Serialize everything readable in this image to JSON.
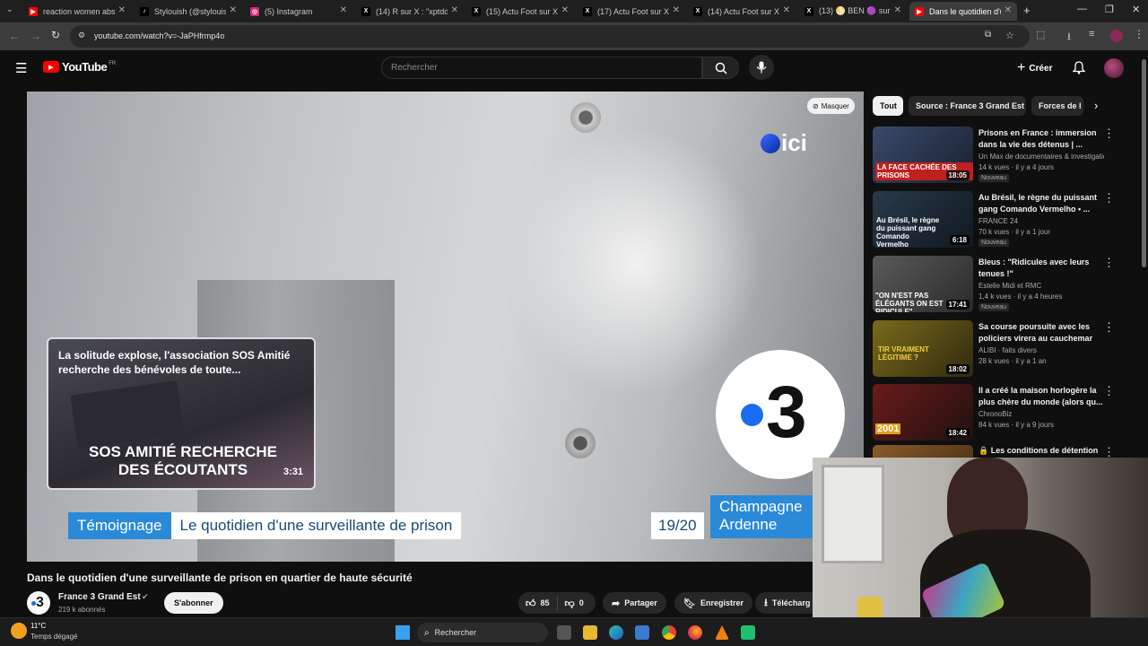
{
  "browser": {
    "tabs": [
      {
        "label": "reaction women abs",
        "icon": "youtube-icon",
        "color": "#ff0000"
      },
      {
        "label": "Stylouish (@stylouish",
        "icon": "tiktok-icon",
        "color": "#000000"
      },
      {
        "label": "(5) Instagram",
        "icon": "instagram-icon",
        "color": "#d62976"
      },
      {
        "label": "(14) R sur X : \"xptdd",
        "icon": "x-icon",
        "color": "#000000"
      },
      {
        "label": "(15) Actu Foot sur X",
        "icon": "x-icon",
        "color": "#000000"
      },
      {
        "label": "(17) Actu Foot sur X",
        "icon": "x-icon",
        "color": "#000000"
      },
      {
        "label": "(14) Actu Foot sur X",
        "icon": "x-icon",
        "color": "#000000"
      },
      {
        "label": "(13) 🌕 BEN 🟣 sur",
        "icon": "x-icon",
        "color": "#000000"
      },
      {
        "label": "Dans le quotidien d'u",
        "icon": "youtube-icon",
        "color": "#ff0000"
      }
    ],
    "url": "youtube.com/watch?v=-JaPHfrmp4o"
  },
  "youtube": {
    "logo_text": "YouTube",
    "region": "FR",
    "search_placeholder": "Rechercher",
    "create_label": "Créer"
  },
  "video": {
    "hide_label": "Masquer",
    "ici_logo": "ici",
    "channel_logo_number": "3",
    "endcard": {
      "title": "La solitude explose, l'association SOS Amitié recherche des bénévoles de toute...",
      "caption": "SOS AMITIÉ RECHERCHE DES ÉCOUTANTS",
      "duration": "3:31"
    },
    "lower_third": {
      "tag": "Témoignage",
      "text": "Le quotidien d'une surveillante de prison",
      "time": "19/20",
      "region_line1": "Champagne",
      "region_line2": "Ardenne"
    },
    "title": "Dans le quotidien d'une surveillante de prison en quartier de haute sécurité",
    "channel": "France 3 Grand Est",
    "subscribers": "219 k abonnés",
    "subscribe_label": "S'abonner",
    "likes": "85",
    "dislikes": "0",
    "share_label": "Partager",
    "save_label": "Enregistrer",
    "download_label": "Télécharg"
  },
  "chips": [
    "Tout",
    "Source : France 3 Grand Est",
    "Forces de l"
  ],
  "recommendations": [
    {
      "title": "Prisons en France : immersion dans la vie des détenus | ...",
      "channel": "Un Max de documentaires & investigatio...",
      "meta": "14 k vues · il y a 4 jours",
      "badge": "Nouveau",
      "duration": "18:05",
      "thumb_text": "LA FACE CACHÉE DES PRISONS",
      "thumb_color": "#3a4a6a"
    },
    {
      "title": "Au Brésil, le règne du puissant gang Comando Vermelho • ...",
      "channel": "FRANCE 24",
      "meta": "70 k vues · il y a 1 jour",
      "badge": "Nouveau",
      "duration": "6:18",
      "thumb_text": "Au Brésil, le règne du puissant gang Comando Vermelho",
      "thumb_color": "#2a3a4a"
    },
    {
      "title": "Bleus : \"Ridicules avec leurs tenues !\"",
      "channel": "Estelle Midi et RMC",
      "meta": "1,4 k vues · il y a 4 heures",
      "badge": "Nouveau",
      "duration": "17:41",
      "thumb_text": "\"ON N'EST PAS ÉLÉGANTS ON EST RIDICULE\"",
      "thumb_color": "#4a4a4a"
    },
    {
      "title": "Sa course poursuite avec les policiers virera au cauchemar",
      "channel": "ALIBI · faits divers",
      "meta": "28 k vues · il y a 1 an",
      "badge": "",
      "duration": "18:02",
      "thumb_text": "TIR VRAIMENT LÉGITIME ?",
      "thumb_color": "#6a5a1a"
    },
    {
      "title": "Il a créé la maison horlogère la plus chère du monde (alors qu...",
      "channel": "ChronoBiz",
      "meta": "84 k vues · il y a 9 jours",
      "badge": "",
      "duration": "18:42",
      "thumb_text": "2001",
      "thumb_color": "#5a1a1a"
    },
    {
      "title": "🔒 Les conditions de détention",
      "channel": "",
      "meta": "",
      "badge": "",
      "duration": "",
      "thumb_text": "",
      "thumb_color": "#8a5a2a"
    }
  ],
  "taskbar": {
    "temperature": "11°C",
    "weather": "Temps dégagé",
    "search_label": "Rechercher"
  }
}
